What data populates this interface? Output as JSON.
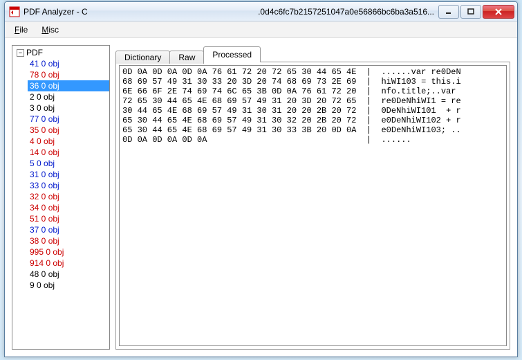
{
  "window": {
    "title_left": "PDF Analyzer - C",
    "title_right": ".0d4c6fc7b2157251047a0e56866bc6ba3a516..."
  },
  "menu": {
    "file": "File",
    "misc": "Misc"
  },
  "tree": {
    "root": "PDF",
    "items": [
      {
        "label": "41 0 obj",
        "color": "blue",
        "selected": false
      },
      {
        "label": "78 0 obj",
        "color": "red",
        "selected": false
      },
      {
        "label": "36 0 obj",
        "color": "blue",
        "selected": true
      },
      {
        "label": "2 0 obj",
        "color": "black",
        "selected": false
      },
      {
        "label": "3 0 obj",
        "color": "black",
        "selected": false
      },
      {
        "label": "77 0 obj",
        "color": "blue",
        "selected": false
      },
      {
        "label": "35 0 obj",
        "color": "red",
        "selected": false
      },
      {
        "label": "4 0 obj",
        "color": "red",
        "selected": false
      },
      {
        "label": "14 0 obj",
        "color": "red",
        "selected": false
      },
      {
        "label": "5 0 obj",
        "color": "blue",
        "selected": false
      },
      {
        "label": "31 0 obj",
        "color": "blue",
        "selected": false
      },
      {
        "label": "33 0 obj",
        "color": "blue",
        "selected": false
      },
      {
        "label": "32 0 obj",
        "color": "red",
        "selected": false
      },
      {
        "label": "34 0 obj",
        "color": "red",
        "selected": false
      },
      {
        "label": "51 0 obj",
        "color": "red",
        "selected": false
      },
      {
        "label": "37 0 obj",
        "color": "blue",
        "selected": false
      },
      {
        "label": "38 0 obj",
        "color": "red",
        "selected": false
      },
      {
        "label": "995 0 obj",
        "color": "red",
        "selected": false
      },
      {
        "label": "914 0 obj",
        "color": "red",
        "selected": false
      },
      {
        "label": "48 0 obj",
        "color": "black",
        "selected": false
      },
      {
        "label": "9 0 obj",
        "color": "black",
        "selected": false
      }
    ]
  },
  "tabs": {
    "dictionary": "Dictionary",
    "raw": "Raw",
    "processed": "Processed",
    "active": "processed"
  },
  "hex": {
    "lines": [
      "0D 0A 0D 0A 0D 0A 76 61 72 20 72 65 30 44 65 4E  |  ......var re0DeN",
      "68 69 57 49 31 30 33 20 3D 20 74 68 69 73 2E 69  |  hiWI103 = this.i",
      "6E 66 6F 2E 74 69 74 6C 65 3B 0D 0A 76 61 72 20  |  nfo.title;..var ",
      "72 65 30 44 65 4E 68 69 57 49 31 20 3D 20 72 65  |  re0DeNhiWI1 = re",
      "30 44 65 4E 68 69 57 49 31 30 31 20 20 2B 20 72  |  0DeNhiWI101  + r",
      "65 30 44 65 4E 68 69 57 49 31 30 32 20 2B 20 72  |  e0DeNhiWI102 + r",
      "65 30 44 65 4E 68 69 57 49 31 30 33 3B 20 0D 0A  |  e0DeNhiWI103; ..",
      "0D 0A 0D 0A 0D 0A                                |  ......"
    ]
  }
}
